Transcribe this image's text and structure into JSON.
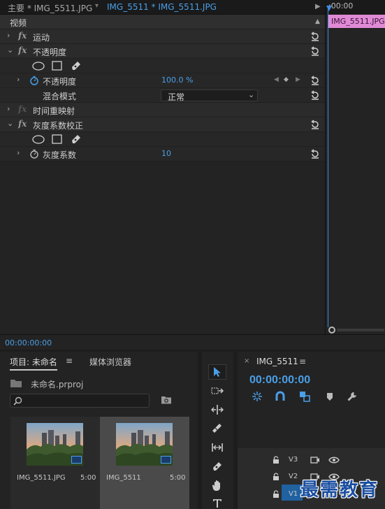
{
  "effect_controls": {
    "tab_main": "主要 * IMG_5511.JPG",
    "tab_clip": "IMG_5511 * IMG_5511.JPG",
    "section_video": "视频",
    "effects": {
      "motion": "运动",
      "opacity": "不透明度",
      "opacity_prop": "不透明度",
      "opacity_value": "100.0 %",
      "blend_mode": "混合模式",
      "blend_mode_value": "正常",
      "time_remap": "时间重映射",
      "gamma": "灰度系数校正",
      "gamma_prop": "灰度系数",
      "gamma_value": "10"
    },
    "timeline_time": ":00:00",
    "clip_bar_label": "IMG_5511.JPG",
    "timecode": "00:00:00:00"
  },
  "project": {
    "tab_label": "项目: 未命名",
    "menu_icon": "≡",
    "tab2_label": "媒体浏览器",
    "project_name": "未命名.prproj",
    "search_placeholder": "",
    "items": [
      {
        "name": "IMG_5511.JPG",
        "duration": "5:00"
      },
      {
        "name": "IMG_5511",
        "duration": "5:00"
      }
    ]
  },
  "sequence": {
    "title": "IMG_5511",
    "menu_icon": "≡",
    "close": "×",
    "timecode": "00:00:00:00",
    "tracks": [
      "V3",
      "V2",
      "V1"
    ]
  },
  "watermark": "最需教育",
  "colors": {
    "accent": "#4a9fe8",
    "clip": "#e08ad6",
    "panel": "#232323"
  }
}
